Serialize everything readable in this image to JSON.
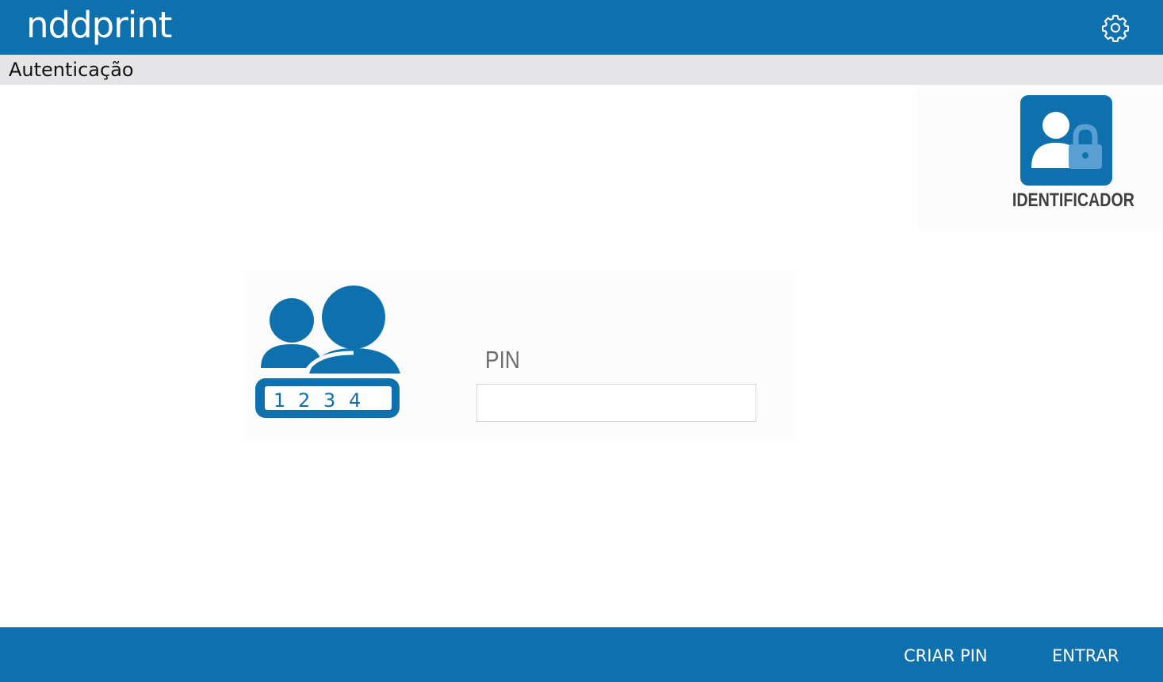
{
  "header": {
    "logo_text": "nddprint",
    "settings_icon": "gear-icon",
    "bar_color": "#0f70ae"
  },
  "subheader": {
    "title": "Autenticação"
  },
  "identifier": {
    "label": "IDENTIFICADOR",
    "icon": "user-lock-icon"
  },
  "login": {
    "illustration_icon": "users-pin-icon",
    "illustration_digits": [
      "1",
      "2",
      "3",
      "4"
    ],
    "pin_label": "PIN",
    "pin_value": "",
    "pin_placeholder": ""
  },
  "footer": {
    "create_pin_label": "CRIAR PIN",
    "enter_label": "ENTRAR"
  }
}
